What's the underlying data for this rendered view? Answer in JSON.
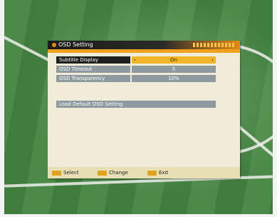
{
  "menu": {
    "title": "OSD Setting",
    "rows": [
      {
        "label": "Subtitle Display",
        "value": "On",
        "selected": true
      },
      {
        "label": "OSD Timeout",
        "value": "5",
        "selected": false
      },
      {
        "label": "OSD Transparency",
        "value": "10%",
        "selected": false
      }
    ],
    "action": "Load Default OSD Setting"
  },
  "footer": {
    "select": "Select",
    "change": "Change",
    "exit": "Exit"
  },
  "colors": {
    "accent": "#f0a11e",
    "selected_value": "#f1b52a",
    "row_bg": "#8e9aa0",
    "panel_bg": "#f1ecd8"
  },
  "icons": {
    "left_arrow": "left-arrow-icon",
    "right_arrow": "right-arrow-icon"
  }
}
